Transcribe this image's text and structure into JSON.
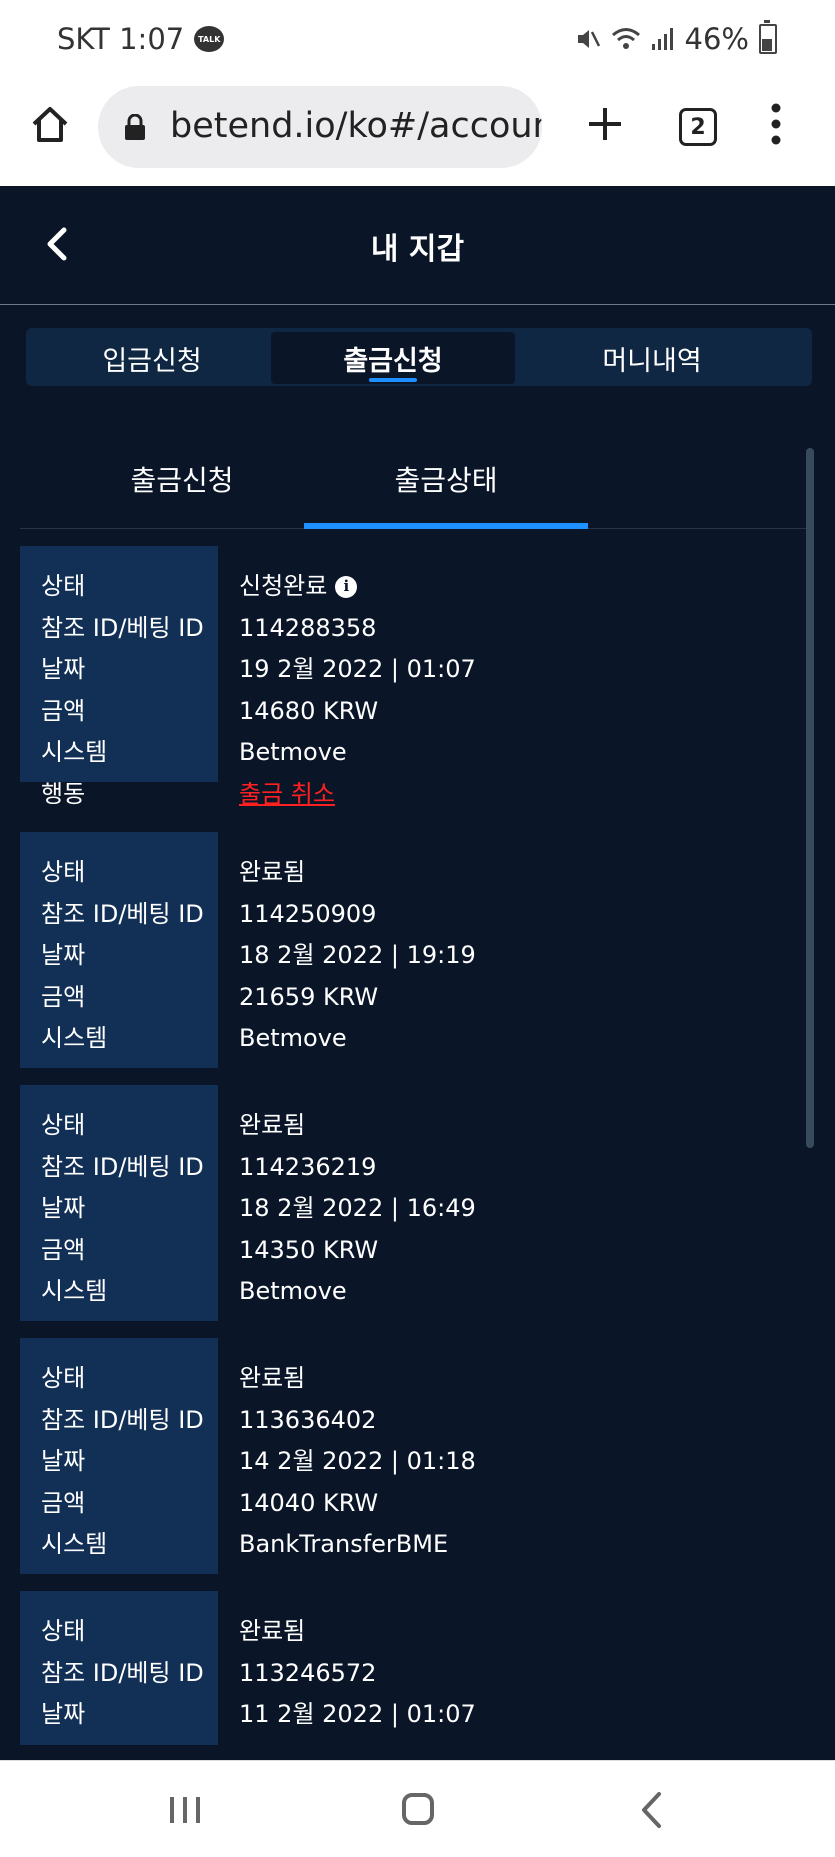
{
  "status_bar": {
    "carrier_time": "SKT 1:07",
    "talk_badge": "TALK",
    "battery": "46%"
  },
  "browser": {
    "url": "betend.io/ko#/account",
    "tab_count": "2"
  },
  "header": {
    "title": "내 지갑"
  },
  "main_tabs": [
    {
      "label": "입금신청",
      "active": false
    },
    {
      "label": "출금신청",
      "active": true
    },
    {
      "label": "머니내역",
      "active": false
    }
  ],
  "sub_tabs": [
    {
      "label": "출금신청",
      "active": false
    },
    {
      "label": "출금상태",
      "active": true
    }
  ],
  "labels": {
    "status": "상태",
    "ref_id": "참조 ID/베팅 ID",
    "date": "날짜",
    "amount": "금액",
    "system": "시스템",
    "action": "행동"
  },
  "records": [
    {
      "status": "신청완료",
      "ref_id": "114288358",
      "date": "19 2월 2022 | 01:07",
      "amount": "14680 KRW",
      "system": "Betmove",
      "action": "출금 취소"
    },
    {
      "status": "완료됨",
      "ref_id": "114250909",
      "date": "18 2월 2022 | 19:19",
      "amount": "21659 KRW",
      "system": "Betmove"
    },
    {
      "status": "완료됨",
      "ref_id": "114236219",
      "date": "18 2월 2022 | 16:49",
      "amount": "14350 KRW",
      "system": "Betmove"
    },
    {
      "status": "완료됨",
      "ref_id": "113636402",
      "date": "14 2월 2022 | 01:18",
      "amount": "14040 KRW",
      "system": "BankTransferBME"
    },
    {
      "status": "완료됨",
      "ref_id": "113246572",
      "date": "11 2월 2022 | 01:07"
    }
  ],
  "colors": {
    "background": "#0a1628",
    "label_panel": "#123056",
    "accent": "#1e90ff",
    "cancel_link": "#ff2020"
  }
}
